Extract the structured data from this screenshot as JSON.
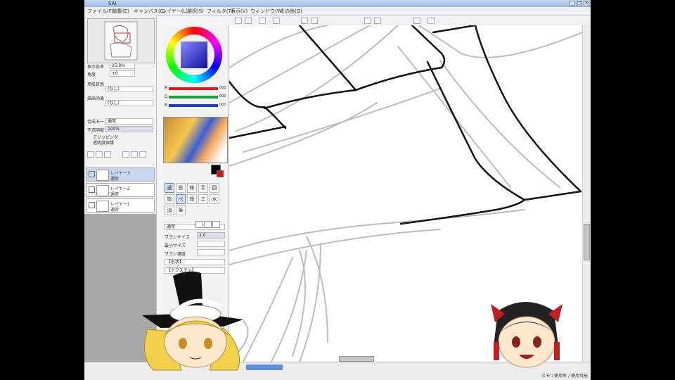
{
  "app": {
    "title": "SAI"
  },
  "menu": [
    "ファイル(F)",
    "編集(E)",
    "キャンバス(C)",
    "レイヤー(L)",
    "選択(S)",
    "フィルタ(T)",
    "表示(V)",
    "ウィンドウ(W)",
    "その他(O)"
  ],
  "left_panel": {
    "zoom_label": "表示倍率",
    "zoom_value": "25.0%",
    "angle_label": "角度",
    "angle_value": "+0",
    "paper_label": "用紙質感",
    "paper_value": "(なし)",
    "effect_label": "描画効果",
    "effect_value": "(なし)",
    "mode_label": "合成モード",
    "mode_value": "通常",
    "opacity_label": "不透明度",
    "opacity_value": "100%",
    "clipping_label": "クリッピング",
    "protect_label": "透明度保護",
    "layers": [
      {
        "name": "レイヤー3",
        "mode": "通常"
      },
      {
        "name": "レイヤー2",
        "mode": "通常"
      },
      {
        "name": "レイヤー1",
        "mode": "通常"
      }
    ]
  },
  "color": {
    "sliders": [
      {
        "label": "R",
        "value": "000",
        "color": "#d02020"
      },
      {
        "label": "G",
        "value": "000",
        "color": "#20a040"
      },
      {
        "label": "B",
        "value": "000",
        "color": "#2040c0"
      }
    ],
    "foreground": "#000000",
    "background": "#e01010",
    "accent": "#5b8ee0"
  },
  "tool_options": {
    "mode_label": "通常",
    "size_label": "ブラシサイズ",
    "size_value": "2.0",
    "min_label": "最小サイズ",
    "density_label": "ブラシ濃度",
    "shape_label": "【形状】",
    "texture_label": "【テクスチャ】"
  },
  "tools": [
    "選",
    "投",
    "移",
    "手",
    "回",
    "拡",
    "ペ",
    "鉛",
    "エ",
    "水",
    "消",
    "筆"
  ],
  "status": {
    "text": "メモリ使用率 / 使用可能"
  }
}
